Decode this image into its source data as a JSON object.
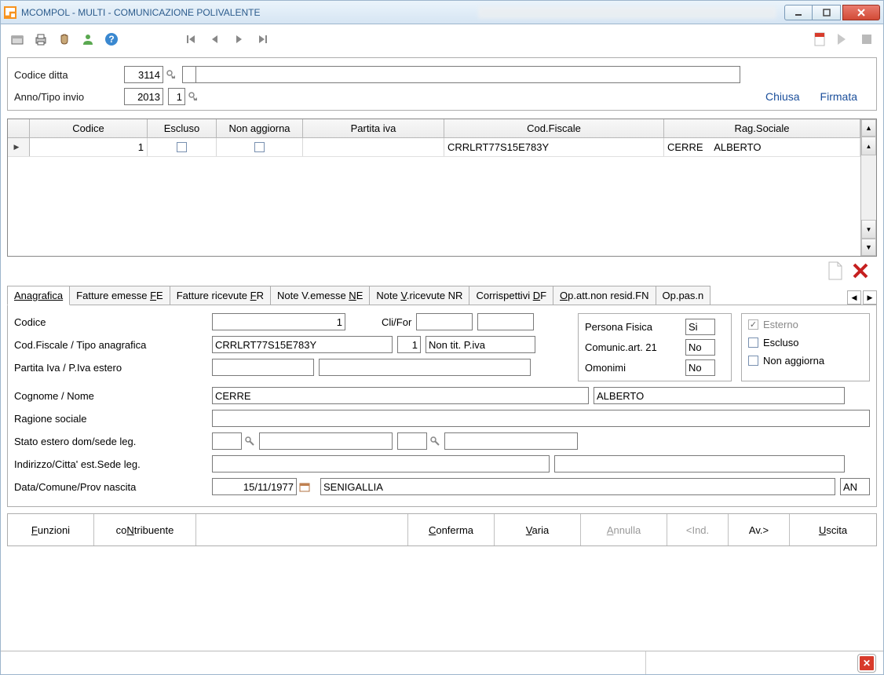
{
  "title": "MCOMPOL - MULTI - COMUNICAZIONE POLIVALENTE",
  "header": {
    "codice_ditta_label": "Codice ditta",
    "codice_ditta": "3114",
    "anno_label": "Anno/Tipo invio",
    "anno": "2013",
    "tipo": "1",
    "status_chiusa": "Chiusa",
    "status_firmata": "Firmata"
  },
  "grid": {
    "cols": [
      "",
      "Codice",
      "Escluso",
      "Non aggiorna",
      "Partita iva",
      "Cod.Fiscale",
      "Rag.Sociale"
    ],
    "rows": [
      {
        "indicator": "▶",
        "codice": "1",
        "escluso": false,
        "non_aggiorna": false,
        "piva": "",
        "cf": "CRRLRT77S15E783Y",
        "rag": "CERRE    ALBERTO"
      }
    ]
  },
  "tabs": {
    "t0": "Anagrafica",
    "t1_a": "Fatture emesse ",
    "t1_b": "F",
    "t1_c": "E",
    "t2_a": "Fatture ricevute ",
    "t2_b": "F",
    "t2_c": "R",
    "t3_a": "Note V.emesse ",
    "t3_b": "N",
    "t3_c": "E",
    "t4_a": "Note ",
    "t4_b": "V",
    "t4_c": ".ricevute NR",
    "t5_a": "Corrispettivi ",
    "t5_b": "D",
    "t5_c": "F",
    "t6_a": "Op.att.non resid.FN",
    "t6_b": "",
    "t6_c": "",
    "t7": "Op.pas.n"
  },
  "form": {
    "codice_label": "Codice",
    "codice": "1",
    "clifor_label": "Cli/For",
    "clifor1": "",
    "clifor2": "",
    "persona_fisica_label": "Persona Fisica",
    "persona_fisica": "Si",
    "comunic_label": "Comunic.art. 21",
    "comunic": "No",
    "omonimi_label": "Omonimi",
    "omonimi": "No",
    "esterno_label": "Esterno",
    "escluso_label": "Escluso",
    "non_aggiorna_label": "Non aggiorna",
    "cf_label": "Cod.Fiscale / Tipo anagrafica",
    "cf": "CRRLRT77S15E783Y",
    "cf_tipo": "1",
    "cf_tipo_txt": "Non tit. P.iva",
    "piva_label": "Partita Iva / P.Iva estero",
    "piva": "",
    "piva_est": "",
    "cognome_label": "Cognome / Nome",
    "cognome": "CERRE",
    "nome": "ALBERTO",
    "rag_label": "Ragione sociale",
    "rag": "",
    "stato_label": "Stato estero dom/sede leg.",
    "ind_label": "Indirizzo/Citta' est.Sede leg.",
    "ind1": "",
    "ind2": "",
    "nascita_label": "Data/Comune/Prov nascita",
    "data_nascita": "15/11/1977",
    "comune_nascita": "SENIGALLIA",
    "prov_nascita": "AN"
  },
  "buttons": {
    "funzioni": "Funzioni",
    "contribuente": "coNtribuente",
    "conferma": "Conferma",
    "varia": "Varia",
    "annulla": "Annulla",
    "ind": "<Ind.",
    "av": "Av.>",
    "uscita": "Uscita"
  }
}
